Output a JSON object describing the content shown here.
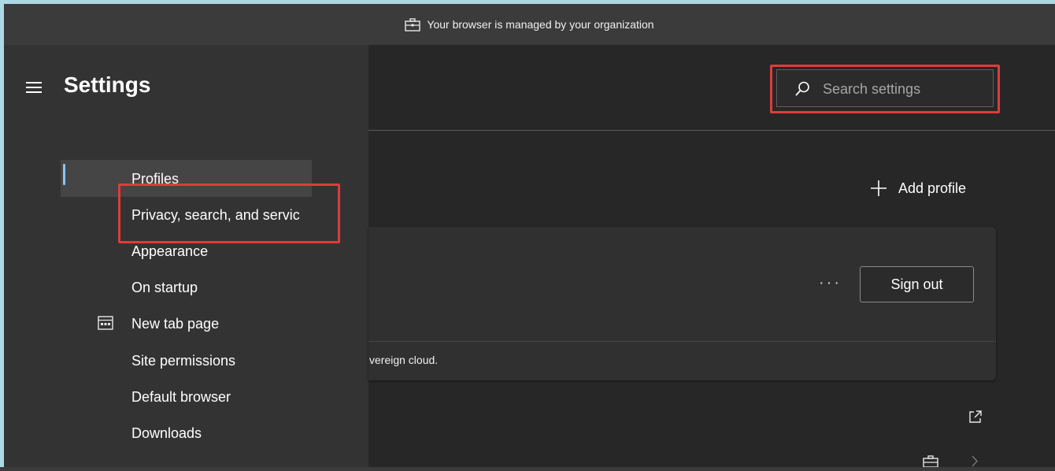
{
  "banner": {
    "text": "Your browser is managed by your organization"
  },
  "sidebar": {
    "title": "Settings",
    "items": [
      {
        "label": "Profiles"
      },
      {
        "label": "Privacy, search, and servic"
      },
      {
        "label": "Appearance"
      },
      {
        "label": "On startup"
      },
      {
        "label": "New tab page"
      },
      {
        "label": "Site permissions"
      },
      {
        "label": "Default browser"
      },
      {
        "label": "Downloads"
      }
    ]
  },
  "search": {
    "placeholder": "Search settings"
  },
  "main": {
    "add_profile_label": "Add profile",
    "more_options": "···",
    "sign_out_label": "Sign out",
    "card_text": "vereign cloud."
  },
  "colors": {
    "annotation": "#e03b3b",
    "accent": "#89c4f4",
    "outer_frame": "#add8e6"
  }
}
